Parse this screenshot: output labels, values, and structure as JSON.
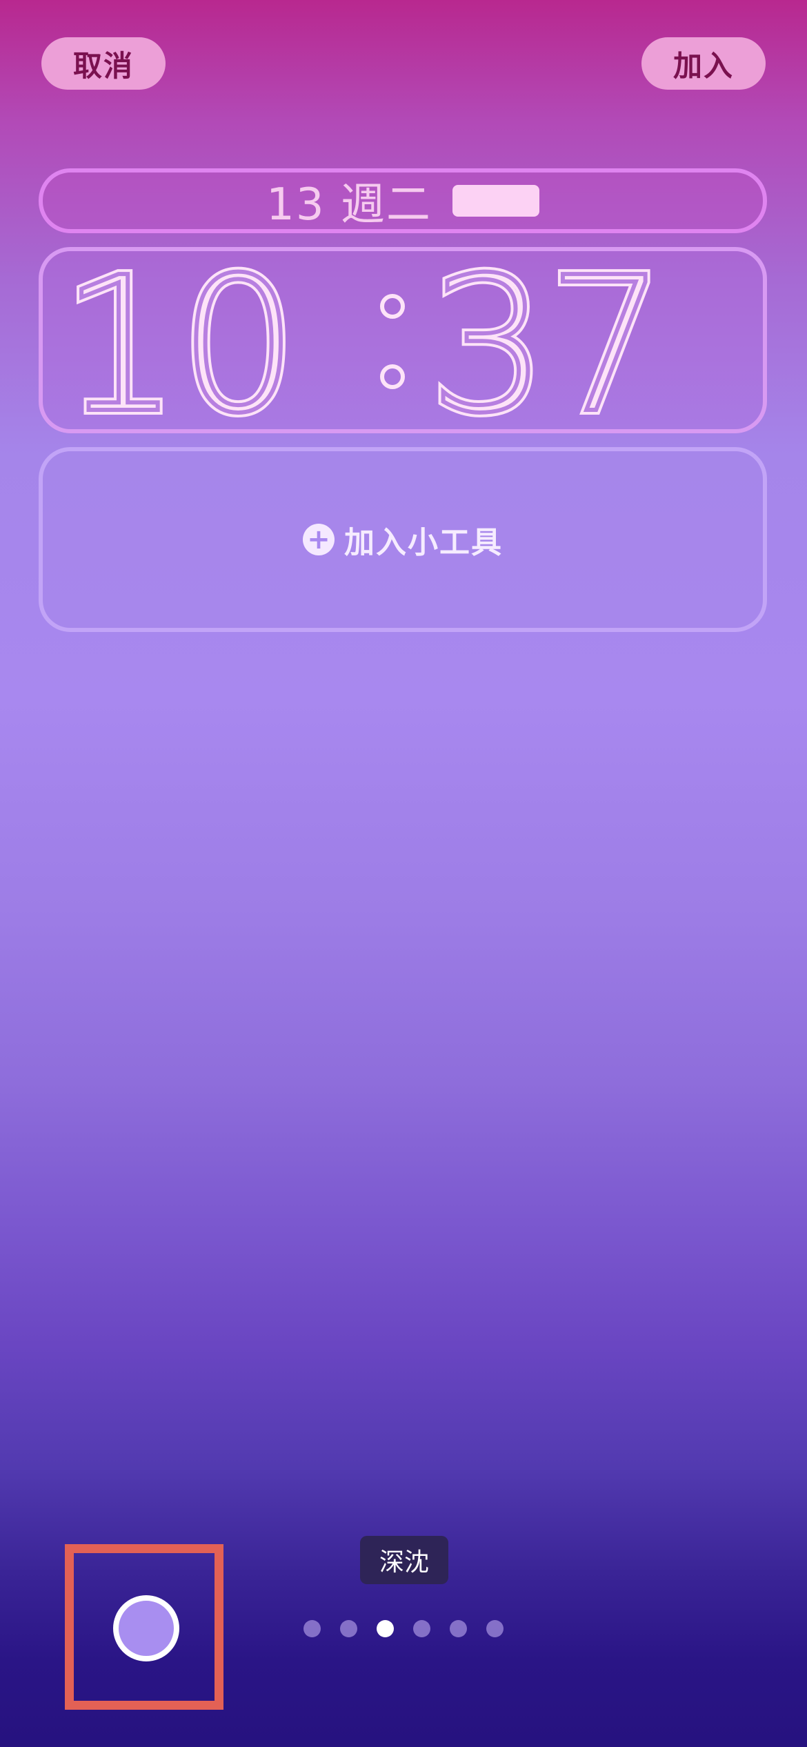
{
  "top_bar": {
    "cancel_label": "取消",
    "add_label": "加入"
  },
  "lock_screen": {
    "date_text": "13 週二",
    "time": {
      "hour": "10",
      "separator": ":",
      "minute": "37"
    },
    "add_widget_label": "加入小工具",
    "add_widget_icon": "plus-circle-icon"
  },
  "style_picker": {
    "current_style_label": "深沈",
    "page_count": 6,
    "active_index": 2
  },
  "colors": {
    "button_fill": "#ec9fd7",
    "button_text": "#7a114f",
    "date_border": "#df84f0",
    "highlight": "#e36155",
    "swatch": "#a88ef0"
  }
}
